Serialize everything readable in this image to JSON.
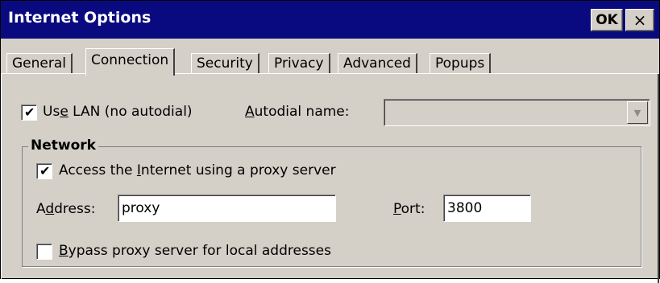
{
  "window": {
    "title": "Internet Options",
    "ok_label": "OK",
    "close_label": "×"
  },
  "tabs": [
    {
      "label": "General"
    },
    {
      "label": "Connection",
      "active": true
    },
    {
      "label": "Security"
    },
    {
      "label": "Privacy"
    },
    {
      "label": "Advanced"
    },
    {
      "label": "Popups"
    }
  ],
  "connection": {
    "use_lan": {
      "label_pre": "Us",
      "label_key": "e",
      "label_post": " LAN (no autodial)",
      "checked": true
    },
    "autodial": {
      "label_key": "A",
      "label_post": "utodial name:",
      "value": ""
    }
  },
  "network": {
    "title": "Network",
    "proxy": {
      "label_pre": "Access the ",
      "label_key": "I",
      "label_post": "nternet using a proxy server",
      "checked": true
    },
    "address": {
      "label_pre": "A",
      "label_key": "d",
      "label_post": "dress:",
      "value": "proxy"
    },
    "port": {
      "label_key": "P",
      "label_post": "ort:",
      "value": "3800"
    },
    "bypass": {
      "label_key": "B",
      "label_post": "ypass proxy server for local addresses",
      "checked": false
    }
  },
  "colors": {
    "titlebar": "#0a0a80",
    "face": "#d4d0c8"
  }
}
